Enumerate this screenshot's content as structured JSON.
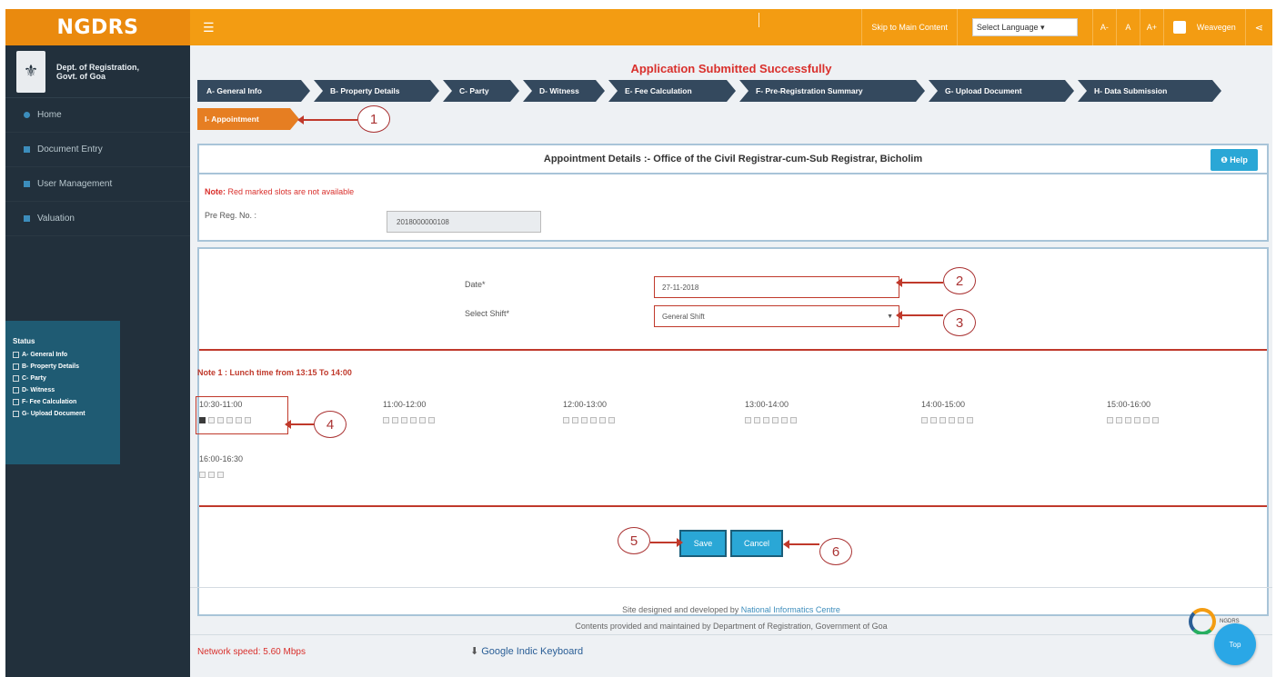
{
  "topbar": {
    "brand": "NGDRS",
    "hamburger_icon": "☰",
    "skip_link": "Skip to Main Content",
    "language_select": "Select Language ▾",
    "font_decrease": "A-",
    "font_normal": "A",
    "font_increase": "A+",
    "user": "Weavegen",
    "share_icon": "⋖"
  },
  "sidebar": {
    "dept_name": "Dept. of Registration, Govt. of Goa",
    "items": [
      {
        "label": "Home"
      },
      {
        "label": "Document Entry"
      },
      {
        "label": "User Management"
      },
      {
        "label": "Valuation"
      }
    ],
    "status": {
      "title": "Status",
      "items": [
        "A- General Info",
        "B- Property Details",
        "C- Party",
        "D- Witness",
        "F- Fee Calculation",
        "G- Upload Document"
      ]
    }
  },
  "main": {
    "submitted_message": "Application Submitted Successfully",
    "steps": [
      "A- General Info",
      "B- Property Details",
      "C- Party",
      "D- Witness",
      "E- Fee Calculation",
      "F- Pre-Registration Summary",
      "G- Upload Document",
      "H- Data Submission"
    ],
    "current_step": "I- Appointment",
    "panel_title": "Appointment Details :- Office of the Civil Registrar-cum-Sub Registrar, Bicholim",
    "help_label": "❶ Help",
    "note_prefix": "Note:",
    "note_text": "Red marked slots are not available",
    "pre_reg_label": "Pre Reg. No. :",
    "pre_reg_value": "2018000000108",
    "date_label": "Date*",
    "date_value": "27-11-2018",
    "shift_label": "Select Shift*",
    "shift_value": "General Shift",
    "lunch_note": "Note 1 : Lunch time from 13:15 To 14:00",
    "slots": [
      {
        "time": "10:30-11:00",
        "count": 6,
        "selected": 1
      },
      {
        "time": "11:00-12:00",
        "count": 6,
        "selected": 0
      },
      {
        "time": "12:00-13:00",
        "count": 6,
        "selected": 0
      },
      {
        "time": "13:00-14:00",
        "count": 6,
        "selected": 0
      },
      {
        "time": "14:00-15:00",
        "count": 6,
        "selected": 0
      },
      {
        "time": "15:00-16:00",
        "count": 6,
        "selected": 0
      },
      {
        "time": "16:00-16:30",
        "count": 3,
        "selected": 0
      }
    ],
    "save_label": "Save",
    "cancel_label": "Cancel",
    "callouts": [
      "1",
      "2",
      "3",
      "4",
      "5",
      "6"
    ]
  },
  "footer": {
    "designed_prefix": "Site designed and developed by",
    "designed_link": "National Informatics Centre",
    "maintained": "Contents provided and maintained by Department of Registration, Government of Goa",
    "logo_text": "NGDRS",
    "network_speed": "Network speed: 5.60 Mbps",
    "keyboard_link": "Google Indic Keyboard",
    "top_label": "Top"
  }
}
